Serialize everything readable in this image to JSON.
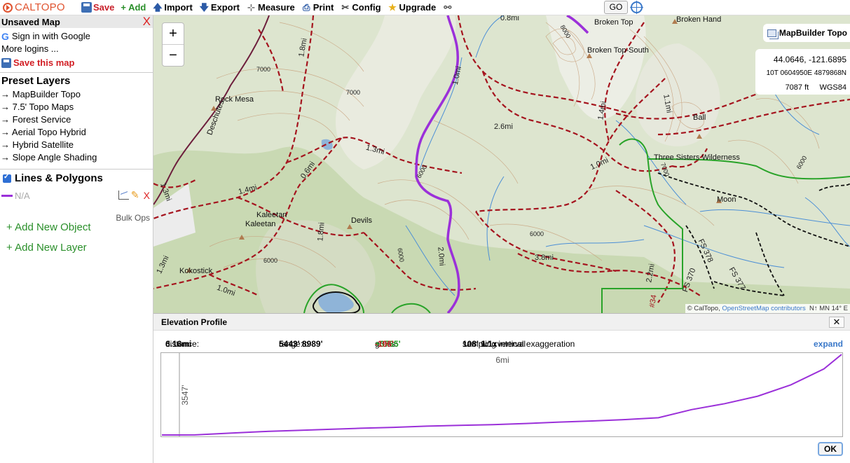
{
  "toolbar": {
    "logo_text": "CALTOPO",
    "save_label": "Save",
    "add_label": "+ Add",
    "import_label": "Import",
    "export_label": "Export",
    "measure_label": "Measure",
    "print_label": "Print",
    "config_label": "Config",
    "upgrade_label": "Upgrade",
    "go_label": "GO",
    "icons": [
      "save-icon",
      "upload-arrow-icon",
      "download-arrow-icon",
      "measure-icon",
      "print-icon",
      "wrench-icon",
      "star-icon",
      "binoculars-icon",
      "locate-crosshair-icon"
    ]
  },
  "sidebar": {
    "map_title": "Unsaved Map",
    "close_symbol": "X",
    "sign_in": "Sign in with Google",
    "more_logins": "More logins ...",
    "save_map": "Save this map",
    "preset_title": "Preset Layers",
    "preset_layers": [
      "→ MapBuilder Topo",
      "→ 7.5' Topo Maps",
      "→ Forest Service",
      "→ Aerial Topo Hybrid",
      "→ Hybrid Satellite",
      "→ Slope Angle Shading"
    ],
    "lines_title": "Lines & Polygons",
    "object_name": "N/A",
    "object_color": "#9b30d9",
    "delete_symbol": "X",
    "bulk_ops": "Bulk Ops",
    "add_object": "+ Add New Object",
    "add_layer": "+ Add New Layer"
  },
  "map": {
    "zoom_in": "+",
    "zoom_out": "−",
    "base_layer": "MapBuilder Topo",
    "coords": {
      "latlon": "44.0646, -121.6895",
      "utm": "10T 0604950E 4879868N",
      "elevation": "7087 ft",
      "datum": "WGS84"
    },
    "attribution_prefix": "© CalTopo, ",
    "attribution_link": "OpenStreetMap contributors",
    "north_label": "N↑ MN 14° E",
    "places": [
      "Broken Top",
      "Broken Hand",
      "Broken Top-South",
      "Rock Mesa",
      "Ball",
      "Three Sisters Wilderness",
      "Moon",
      "Kaleetan",
      "Kaleetan",
      "Devils",
      "Kokostick",
      "Deschutes"
    ],
    "distances": [
      "0.8mi",
      "1.8mi",
      "1.0mi",
      "2.6mi",
      "1.1mi",
      "1.4mi",
      "1.3mi",
      "1.0mi",
      "0.6mi",
      "1.4mi",
      "1.8mi",
      "2.0mi",
      "3.8mi",
      "1.3mi",
      "1.0mi",
      "2.2mi",
      "1.3mi"
    ],
    "contours": [
      "7000",
      "6000",
      "6000",
      "6000",
      "6000",
      "8000",
      "7000",
      "7000",
      "6000"
    ],
    "roads": [
      "FS 378",
      "FS 370",
      "FS 377",
      "#34"
    ]
  },
  "elevation_profile": {
    "title": "Elevation Profile",
    "close_symbol": "✕",
    "distance_label": "distance:",
    "distance_value": "6.16mi",
    "range_label": "range:",
    "range_min": "5443'",
    "range_to": "to",
    "range_max": "8989'",
    "gross_label": "gross:",
    "gain": "+3735'",
    "loss": "-196'",
    "sampling_label": "sampling interval",
    "sampling_value": "108'",
    "sampling_w": "w/",
    "exaggeration": "1.1x",
    "exaggeration_label": "vertical exaggeration",
    "expand": "expand",
    "ok_label": "OK",
    "chart_data": {
      "type": "line",
      "x_tick_label": "6mi",
      "y_tick_label": "3547'",
      "series": [
        {
          "color": "#9b30d9",
          "x": [
            0,
            0.3,
            0.6,
            0.9,
            1.2,
            1.5,
            1.8,
            2.1,
            2.4,
            2.7,
            3.0,
            3.3,
            3.6,
            3.9,
            4.2,
            4.5,
            4.8,
            5.1,
            5.4,
            5.7,
            6.0,
            6.16
          ],
          "y": [
            5443,
            5445,
            5520,
            5590,
            5640,
            5690,
            5740,
            5780,
            5830,
            5870,
            5900,
            5950,
            6010,
            6060,
            6120,
            6200,
            6560,
            6820,
            7150,
            7650,
            8350,
            8989
          ]
        }
      ]
    }
  }
}
